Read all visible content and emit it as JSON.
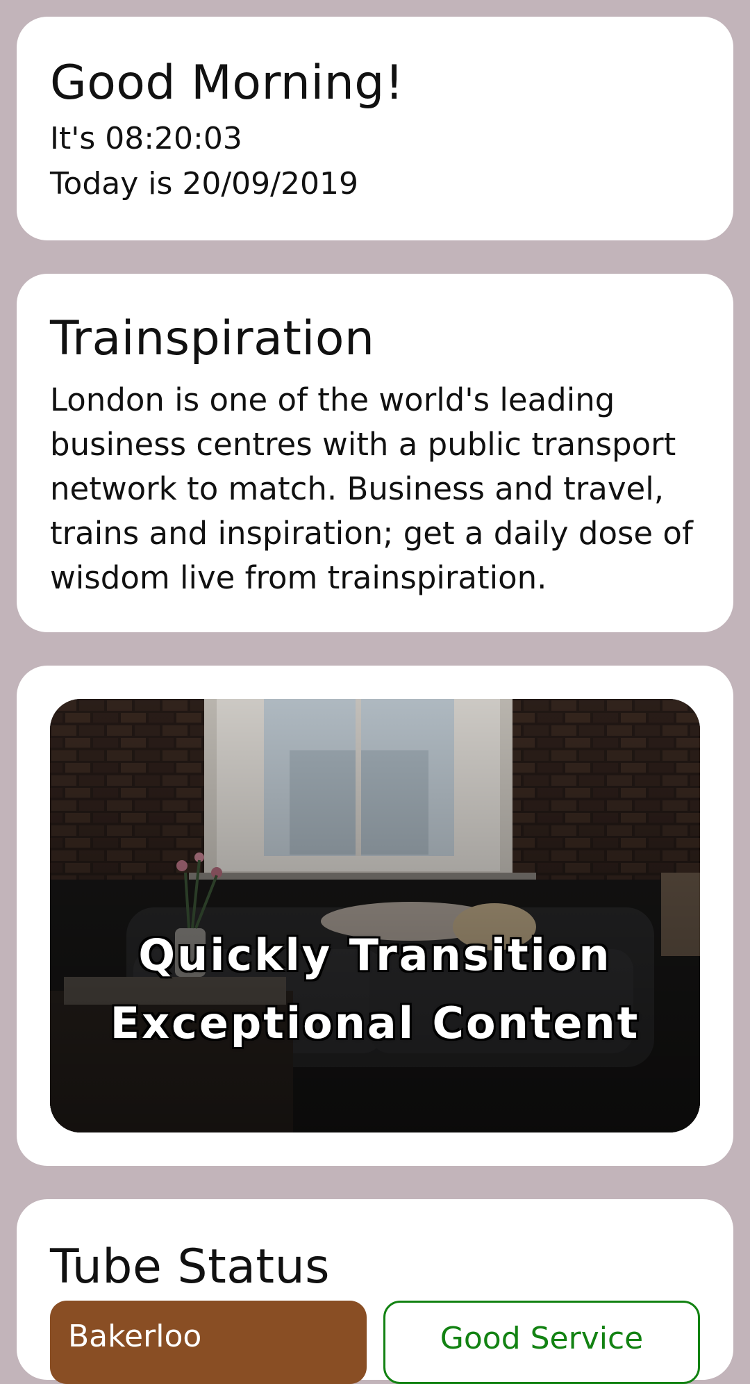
{
  "greeting": {
    "title": "Good Morning!",
    "time_line": "It's 08:20:03",
    "date_line": "Today is 20/09/2019"
  },
  "trainspiration": {
    "title": "Trainspiration",
    "body": "London is one of the world's leading business centres with a public transport network to match. Business and travel, trains and inspiration; get a daily dose of wisdom live from trainspiration."
  },
  "hero": {
    "caption_line1": "Quickly Transition",
    "caption_line2": "Exceptional Content"
  },
  "tube_status": {
    "title": "Tube Status",
    "line_name": "Bakerloo",
    "status": "Good Service"
  },
  "colors": {
    "page_background": "#c2b4ba",
    "card_background": "#ffffff",
    "bakerloo_line": "#894e24",
    "good_service": "#128212"
  }
}
